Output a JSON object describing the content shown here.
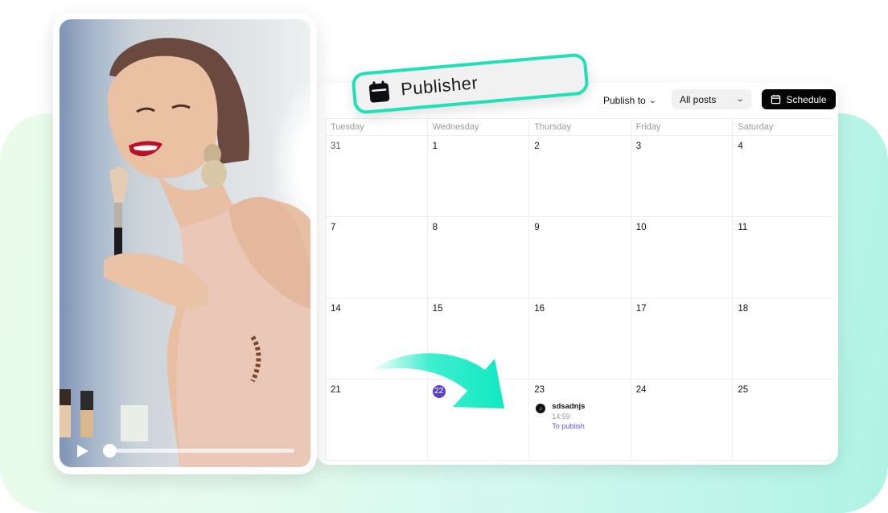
{
  "colors": {
    "accent_teal": "#1fe0b6",
    "today_purple": "#5b3ed6",
    "status_purple": "#6b4ee0",
    "schedule_button_bg": "#050505"
  },
  "badge": {
    "icon": "calendar-icon",
    "label": "Publisher"
  },
  "toolbar": {
    "publish_to_label": "Publish to",
    "filter_value": "All posts",
    "schedule_label": "Schedule",
    "schedule_icon": "calendar-icon"
  },
  "calendar": {
    "weekdays": [
      "Tuesday",
      "Wednesday",
      "Thursday",
      "Friday",
      "Saturday"
    ],
    "weeks": [
      [
        "31",
        "1",
        "2",
        "3",
        "4"
      ],
      [
        "7",
        "8",
        "9",
        "10",
        "11"
      ],
      [
        "14",
        "15",
        "16",
        "17",
        "18"
      ],
      [
        "21",
        "22",
        "23",
        "24",
        "25"
      ]
    ],
    "today": "22",
    "event": {
      "day": "23",
      "icon": "tiktok-icon",
      "title": "sdsadnjs",
      "time": "14:59",
      "status": "To publish"
    }
  },
  "video": {
    "play_icon": "play-icon",
    "progress": 0.04
  }
}
